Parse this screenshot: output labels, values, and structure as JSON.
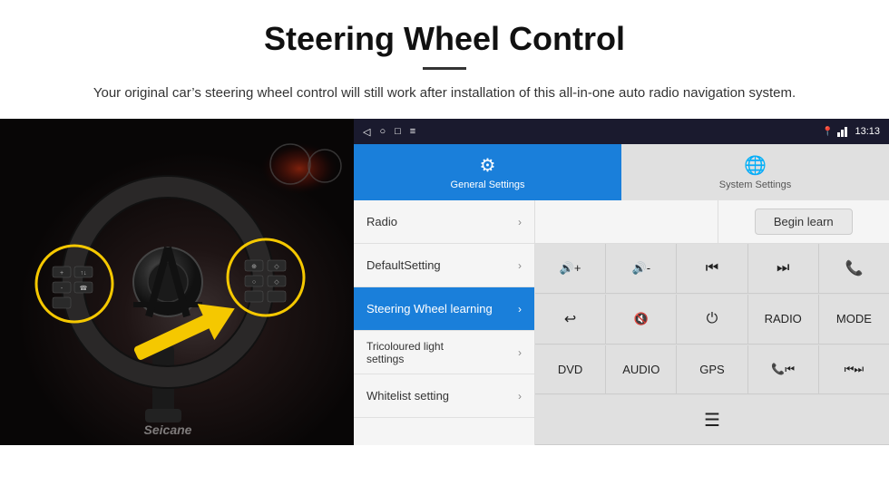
{
  "header": {
    "title": "Steering Wheel Control",
    "subtitle": "Your original car’s steering wheel control will still work after installation of this all-in-one auto radio navigation system."
  },
  "android": {
    "status_bar": {
      "icons": [
        "◁",
        "○",
        "□",
        "≡"
      ],
      "time": "13:13",
      "wifi_label": "wifi"
    },
    "tabs": [
      {
        "label": "General Settings",
        "icon": "⚙",
        "active": true
      },
      {
        "label": "System Settings",
        "icon": "🌐",
        "active": false
      }
    ],
    "menu_items": [
      {
        "label": "Radio",
        "active": false
      },
      {
        "label": "DefaultSetting",
        "active": false
      },
      {
        "label": "Steering Wheel learning",
        "active": true
      },
      {
        "label": "Tricoloured light settings",
        "active": false
      },
      {
        "label": "Whitelist setting",
        "active": false
      }
    ],
    "begin_learn_label": "Begin learn",
    "controls": {
      "row1": [
        "🔊+",
        "🔊−",
        "⏮",
        "⏭",
        "📞"
      ],
      "row2": [
        "↩",
        "🔇",
        "⏻",
        "RADIO",
        "MODE"
      ],
      "row3": [
        "DVD",
        "AUDIO",
        "GPS",
        "📞⏮",
        "⏮⏭"
      ],
      "row4": [
        "≡"
      ]
    }
  },
  "watermark": "Seicane"
}
